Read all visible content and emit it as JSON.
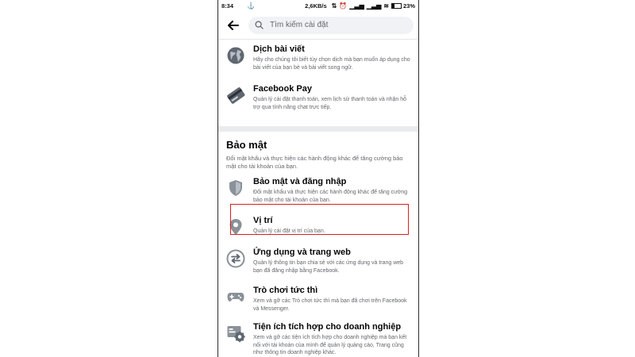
{
  "status_bar": {
    "time": "8:34",
    "network_speed": "2,6KB/s",
    "battery": "23%"
  },
  "header": {
    "search_placeholder": "Tìm kiếm cài đặt"
  },
  "items_top": [
    {
      "title": "Dịch bài viết",
      "description": "Hãy cho chúng tôi biết tùy chọn dịch mà bạn muốn áp dụng cho bài viết của bạn bè và bài viết song ngữ.",
      "icon": "globe-icon"
    },
    {
      "title": "Facebook Pay",
      "description": "Quản lý cài đặt thanh toán, xem lịch sử thanh toán và nhận hỗ trợ qua tính năng chat trực tiếp.",
      "icon": "credit-card-icon"
    }
  ],
  "security_section": {
    "title": "Bảo mật",
    "description": "Đổi mật khẩu và thực hiện các hành động khác để tăng cường bảo mật cho tài khoản của bạn.",
    "items": [
      {
        "title": "Bảo mật và đăng nhập",
        "description": "Đổi mật khẩu và thực hiện các hành động khác để tăng cường bảo mật cho tài khoản của bạn.",
        "icon": "shield-icon"
      },
      {
        "title": "Vị trí",
        "description": "Quản lý cài đặt vị trí của bạn.",
        "icon": "location-pin-icon"
      },
      {
        "title": "Ứng dụng và trang web",
        "description": "Quản lý thông tin bạn chia sẻ với các ứng dụng và trang web bạn đã đăng nhập bằng Facebook.",
        "icon": "swap-arrows-icon"
      },
      {
        "title": "Trò chơi tức thì",
        "description": "Xem và gỡ các Trò chơi tức thì mà bạn đã chơi trên Facebook và Messenger.",
        "icon": "gamepad-icon"
      },
      {
        "title": "Tiện ích tích hợp cho doanh nghiệp",
        "description": "Xem và gỡ các tiện ích tích hợp cho doanh nghiệp mà bạn kết nối với tài khoản của mình để quản lý quảng cáo, Trang cũng như thông tin doanh nghiệp khác.",
        "icon": "business-settings-icon"
      }
    ]
  },
  "colors": {
    "highlight_border": "#d9201b",
    "icon_gray": "#8a9199",
    "divider": "#e9ebee"
  }
}
